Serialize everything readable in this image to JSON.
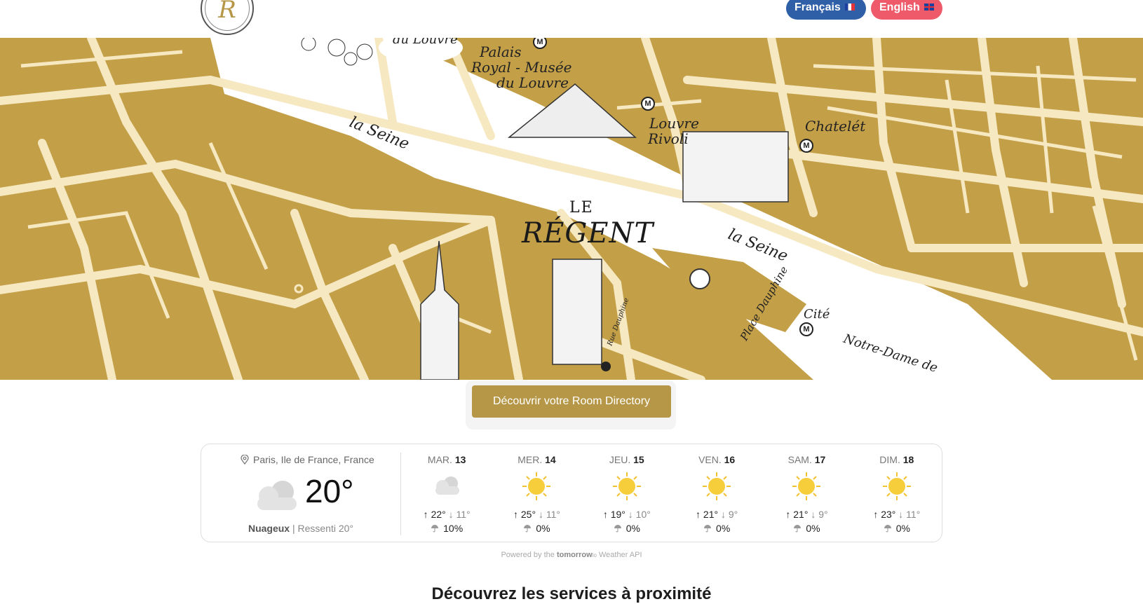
{
  "header": {
    "logo_letter": "R",
    "lang_fr": "Français",
    "lang_en": "English"
  },
  "map": {
    "labels": {
      "louvre_top": "du Louvre",
      "palais": "Palais",
      "royal": "Royal - Musée",
      "du_louvre": "du Louvre",
      "seine_1": "la Seine",
      "seine_2": "la Seine",
      "louvre_rivoli_1": "Louvre",
      "louvre_rivoli_2": "Rivoli",
      "chatelet": "Chatelét",
      "place_dauphine": "Place Dauphine",
      "rue_dauphine": "Rue Dauphine",
      "cite": "Cité",
      "notre_dame": "Notre-Dame de"
    },
    "brand_le": "LE",
    "brand_regent": "RÉGENT"
  },
  "cta": {
    "label": "Découvrir votre Room Directory"
  },
  "weather": {
    "location": "Paris, Ile de France, France",
    "current_temp": "20°",
    "condition": "Nuageux",
    "feels_like": "Ressenti 20°",
    "days": [
      {
        "dow": "MAR.",
        "date": "13",
        "icon": "cloud-icon",
        "high": "22°",
        "low": "11°",
        "rain": "10%"
      },
      {
        "dow": "MER.",
        "date": "14",
        "icon": "sun-icon",
        "high": "25°",
        "low": "11°",
        "rain": "0%"
      },
      {
        "dow": "JEU.",
        "date": "15",
        "icon": "sun-icon",
        "high": "19°",
        "low": "10°",
        "rain": "0%"
      },
      {
        "dow": "VEN.",
        "date": "16",
        "icon": "sun-icon",
        "high": "21°",
        "low": "9°",
        "rain": "0%"
      },
      {
        "dow": "SAM.",
        "date": "17",
        "icon": "sun-icon",
        "high": "21°",
        "low": "9°",
        "rain": "0%"
      },
      {
        "dow": "DIM.",
        "date": "18",
        "icon": "sun-icon",
        "high": "23°",
        "low": "11°",
        "rain": "0%"
      }
    ]
  },
  "powered": {
    "prefix": "Powered by the",
    "brand": "tomorrow",
    "brand_suffix": "io",
    "suffix": "Weather API"
  },
  "section_title": "Découvrez les services à proximité",
  "colors": {
    "gold": "#b69747",
    "map_gold": "#c39f48",
    "road": "#f6e8c0",
    "river": "#ffffff",
    "fr_blue": "#2f5fa6",
    "en_red": "#ef5a6a"
  }
}
